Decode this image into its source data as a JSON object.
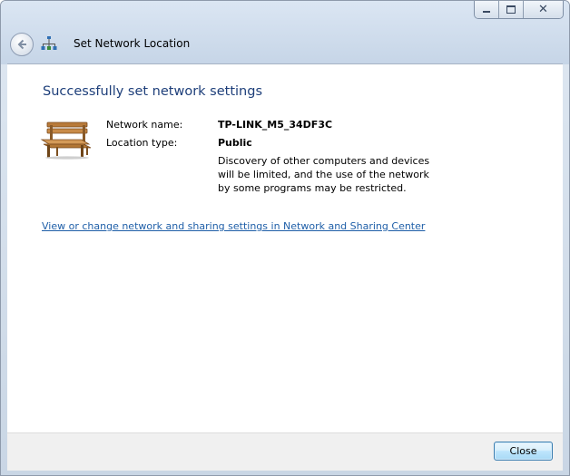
{
  "window": {
    "title": "Set Network Location"
  },
  "content": {
    "heading": "Successfully set network settings",
    "network_name_label": "Network name:",
    "network_name_value": "TP-LINK_M5_34DF3C",
    "location_type_label": "Location type:",
    "location_type_value": "Public",
    "description": [
      "Discovery of other computers and devices",
      "will be limited, and the use of the network",
      "by some programs may be restricted."
    ],
    "link_text": "View or change network and sharing settings in Network and Sharing Center"
  },
  "footer": {
    "close_label": "Close"
  },
  "icons": {
    "back": "back-arrow-icon",
    "network": "network-icon",
    "location": "park-bench-icon"
  },
  "colors": {
    "heading": "#1e3f7a",
    "link": "#1f5fa8",
    "button_border": "#3c7fb1"
  }
}
